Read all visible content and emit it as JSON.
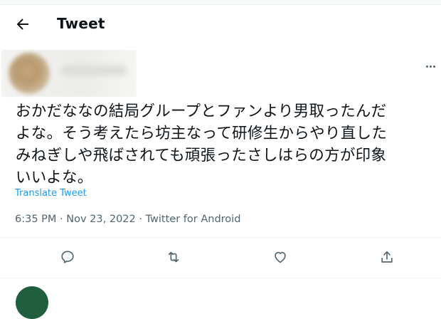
{
  "header": {
    "title": "Tweet",
    "back_icon": "arrow-left-icon"
  },
  "tweet": {
    "text": "おかだななの結局グループとファンより男取ったんだ\nよな。そう考えたら坊主なって研修生からやり直した\nみねぎしや飛ばされても頑張ったさしはらの方が印象\nいいよな。",
    "translate_label": "Translate Tweet",
    "time": "6:35 PM",
    "date": "Nov 23, 2022",
    "source": "Twitter for Android"
  },
  "actions": [
    {
      "name": "reply",
      "icon": "reply-icon"
    },
    {
      "name": "retweet",
      "icon": "retweet-icon"
    },
    {
      "name": "like",
      "icon": "heart-icon"
    },
    {
      "name": "share",
      "icon": "share-icon"
    }
  ],
  "colors": {
    "accent": "#1d9bf0",
    "secondary_text": "#536471",
    "text": "#0f1419",
    "border": "#eff3f4"
  }
}
